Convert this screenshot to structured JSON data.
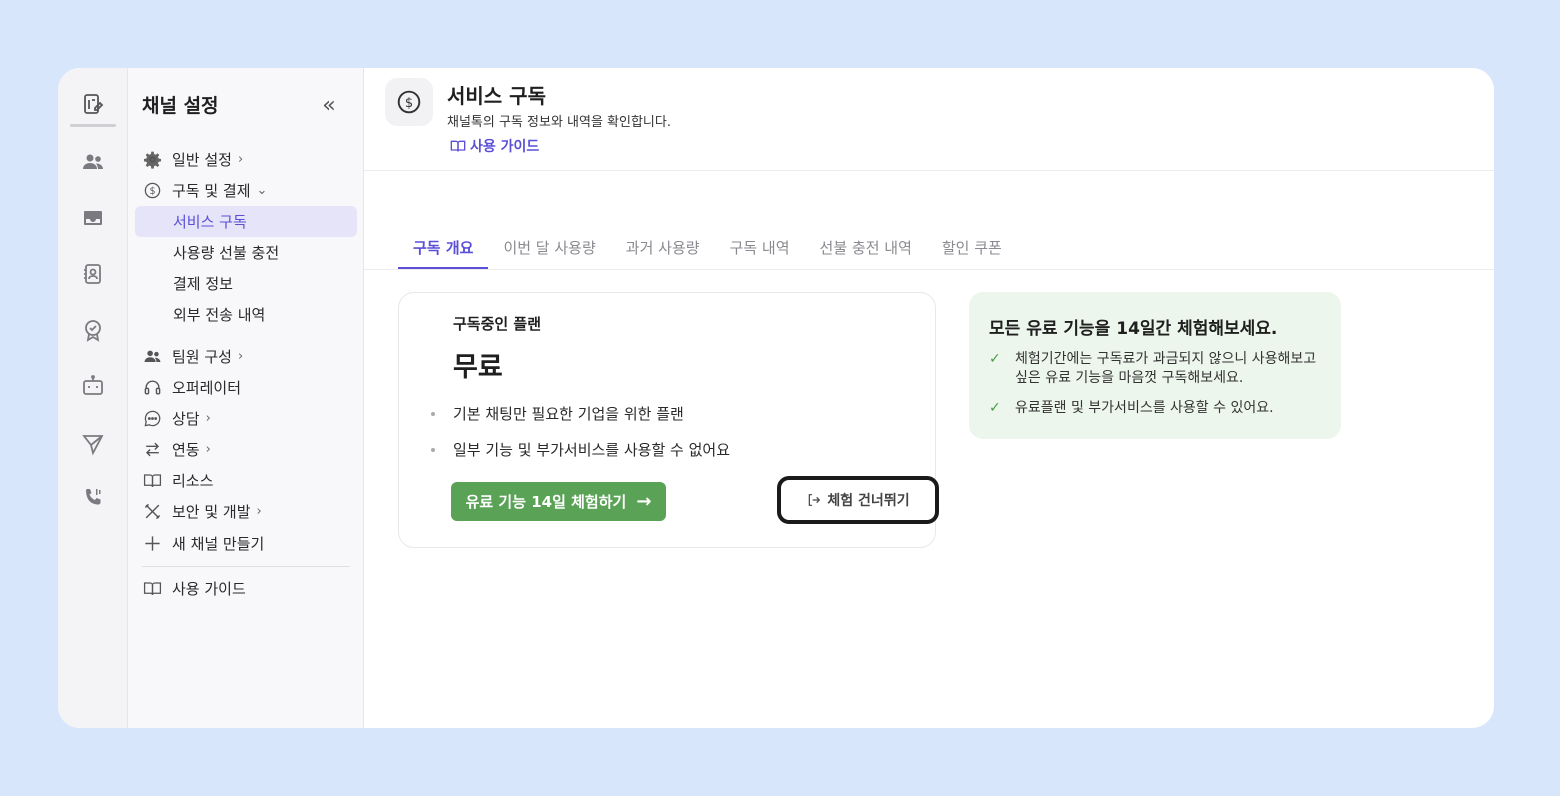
{
  "sidebar": {
    "title": "채널 설정",
    "items": {
      "general": "일반 설정",
      "billing": "구독 및 결제",
      "billing_sub": [
        "서비스 구독",
        "사용량 선불 충전",
        "결제 정보",
        "외부 전송 내역"
      ],
      "team": "팀원 구성",
      "operator": "오퍼레이터",
      "consult": "상담",
      "integration": "연동",
      "resources": "리소스",
      "security": "보안 및 개발",
      "new_channel": "새 채널 만들기",
      "guide": "사용 가이드"
    }
  },
  "header": {
    "title": "서비스 구독",
    "description": "채널톡의 구독 정보와 내역을 확인합니다.",
    "guide_link": "사용 가이드"
  },
  "tabs": [
    "구독 개요",
    "이번 달 사용량",
    "과거 사용량",
    "구독 내역",
    "선불 충전 내역",
    "할인 쿠폰"
  ],
  "plan": {
    "label": "구독중인 플랜",
    "name": "무료",
    "bullets": [
      "기본 채팅만 필요한 기업을 위한 플랜",
      "일부 기능 및 부가서비스를 사용할 수 없어요"
    ],
    "trial_button": "유료 기능 14일 체험하기",
    "skip_button": "체험 건너뛰기"
  },
  "promo": {
    "title": "모든 유료 기능을 14일간 체험해보세요.",
    "items": [
      "체험기간에는 구독료가 과금되지 않으니 사용해보고 싶은 유료 기능을 마음껏 구독해보세요.",
      "유료플랜 및 부가서비스를 사용할 수 있어요."
    ]
  },
  "colors": {
    "accent": "#5b4fd8",
    "trial_green": "#5aa256",
    "promo_bg": "#edf6ec",
    "background": "#d8e6fc"
  }
}
